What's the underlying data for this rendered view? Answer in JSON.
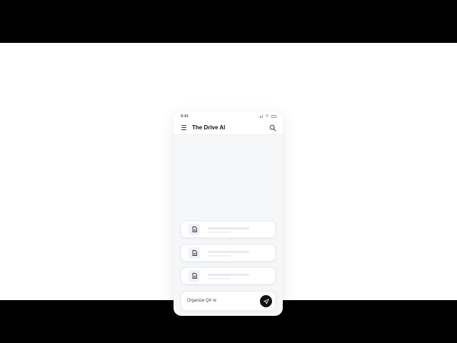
{
  "status_bar": {
    "time": "9:41"
  },
  "app_bar": {
    "title": "The Drive AI"
  },
  "file_cards": [
    {
      "icon": "document-icon"
    },
    {
      "icon": "document-icon"
    },
    {
      "icon": "document-icon"
    }
  ],
  "composer": {
    "text": "Organize Q4 re"
  },
  "colors": {
    "background": "#ffffff",
    "accent": "#111111",
    "letterbox": "#000000"
  }
}
